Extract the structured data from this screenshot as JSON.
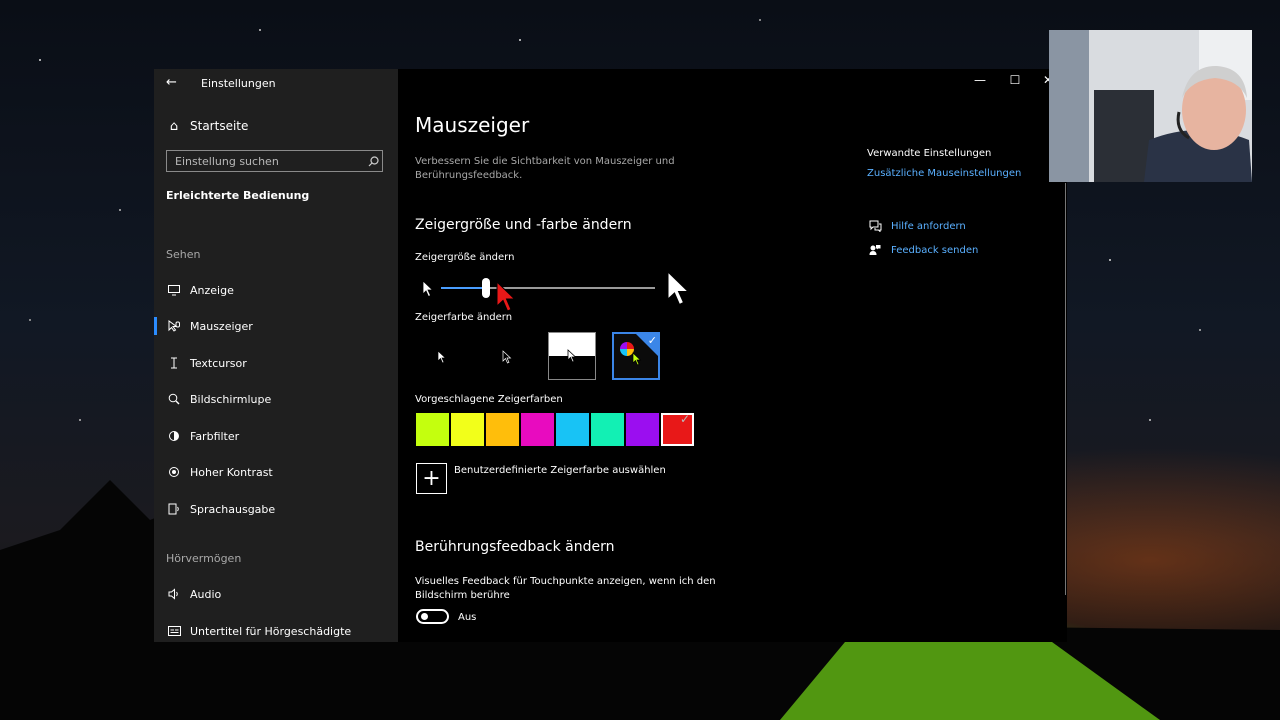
{
  "window": {
    "title": "Einstellungen",
    "controls": {
      "minimize": "—",
      "maximize": "☐",
      "close": "✕"
    }
  },
  "sidebar": {
    "home": "Startseite",
    "search_placeholder": "Einstellung suchen",
    "section_title": "Erleichterte Bedienung",
    "category_see": "Sehen",
    "items": [
      {
        "label": "Anzeige",
        "icon": "monitor-icon"
      },
      {
        "label": "Mauszeiger",
        "icon": "mouse-pointer-icon",
        "active": true
      },
      {
        "label": "Textcursor",
        "icon": "text-cursor-icon"
      },
      {
        "label": "Bildschirmlupe",
        "icon": "magnifier-icon"
      },
      {
        "label": "Farbfilter",
        "icon": "color-filter-icon"
      },
      {
        "label": "Hoher Kontrast",
        "icon": "contrast-icon"
      },
      {
        "label": "Sprachausgabe",
        "icon": "narrator-icon"
      }
    ],
    "category_hearing": "Hörvermögen",
    "items_hearing": [
      {
        "label": "Audio",
        "icon": "speaker-icon"
      },
      {
        "label": "Untertitel für Hörgeschädigte",
        "icon": "captions-icon"
      }
    ]
  },
  "main": {
    "title": "Mauszeiger",
    "description": "Verbessern Sie die Sichtbarkeit von Mauszeiger und Berührungsfeedback.",
    "section1_title": "Zeigergröße und -farbe ändern",
    "size_label": "Zeigergröße ändern",
    "size_value": 0.21,
    "color_label": "Zeigerfarbe ändern",
    "suggested_label": "Vorgeschlagene Zeigerfarben",
    "suggested_colors": [
      "#c4ff0e",
      "#f2ff1a",
      "#ffbe0b",
      "#e80bbf",
      "#18c3f5",
      "#12f0b4",
      "#9b0ef0",
      "#e81818"
    ],
    "selected_color": "#e81818",
    "custom_color_label": "Benutzerdefinierte Zeigerfarbe auswählen",
    "section2_title": "Berührungsfeedback ändern",
    "touch_label": "Visuelles Feedback für Touchpunkte anzeigen, wenn ich den Bildschirm berühre",
    "toggle_text": "Aus"
  },
  "related": {
    "title": "Verwandte Einstellungen",
    "link": "Zusätzliche Mauseinstellungen",
    "help": "Hilfe anfordern",
    "feedback": "Feedback senden"
  },
  "colors": {
    "accent": "#4a9eff",
    "link": "#5ab0ff",
    "sidebar_bg": "#1f1f1f",
    "main_bg": "#000000"
  }
}
